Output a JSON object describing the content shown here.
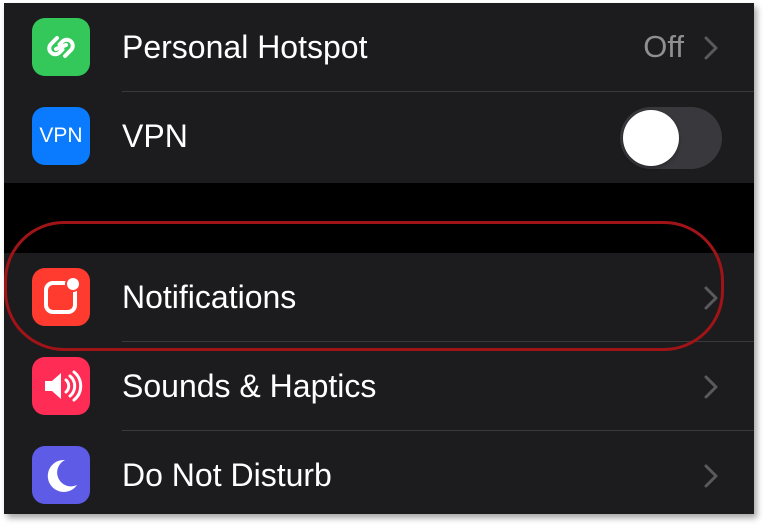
{
  "settings": {
    "group1": [
      {
        "label": "Personal Hotspot",
        "value": "Off",
        "icon": "hotspot-icon",
        "icon_color": "#34c759"
      },
      {
        "label": "VPN",
        "icon_text": "VPN",
        "icon": "vpn-icon",
        "icon_color": "#0a7aff",
        "toggle_on": false
      }
    ],
    "group2": [
      {
        "label": "Notifications",
        "icon": "notifications-icon",
        "icon_color": "#ff3b30"
      },
      {
        "label": "Sounds & Haptics",
        "icon": "speaker-icon",
        "icon_color": "#ff2d55"
      },
      {
        "label": "Do Not Disturb",
        "icon": "moon-icon",
        "icon_color": "#5e5ce6"
      }
    ]
  },
  "highlight": {
    "target": "Notifications",
    "color": "#a01418"
  }
}
